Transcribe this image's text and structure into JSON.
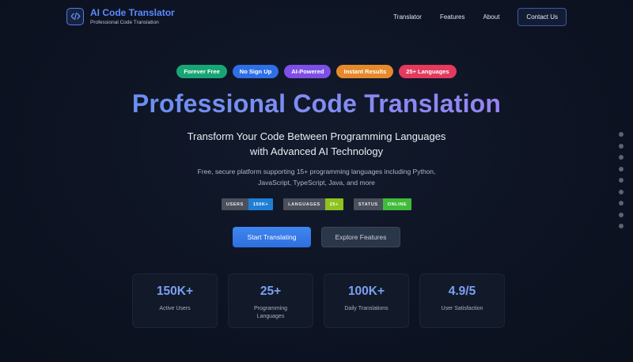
{
  "brand": {
    "title": "AI Code Translator",
    "subtitle": "Professional Code Translation",
    "logo_icon": "code-brackets-icon",
    "accent": "#5b8bff"
  },
  "nav": {
    "links": [
      "Translator",
      "Features",
      "About"
    ],
    "contact_label": "Contact Us"
  },
  "badges": [
    {
      "label": "Forever Free",
      "color": "#17a673"
    },
    {
      "label": "No Sign Up",
      "color": "#2f6fe6"
    },
    {
      "label": "AI-Powered",
      "color": "#7e4fe6"
    },
    {
      "label": "Instant Results",
      "color": "#e58a2b"
    },
    {
      "label": "25+ Languages",
      "color": "#e33a5d"
    }
  ],
  "hero": {
    "title": "Professional Code Translation",
    "subtitle_line1": "Transform Your Code Between Programming Languages",
    "subtitle_line2": "with Advanced AI Technology",
    "desc_line1": "Free, secure platform supporting 15+ programming languages including Python,",
    "desc_line2": "JavaScript, TypeScript, Java, and more"
  },
  "status_pills": [
    {
      "key": "USERS",
      "value": "150K+",
      "color": "#1f7fd6"
    },
    {
      "key": "LANGUAGES",
      "value": "25+",
      "color": "#8fc21f"
    },
    {
      "key": "STATUS",
      "value": "ONLINE",
      "color": "#3fbd3a"
    }
  ],
  "cta": {
    "primary": "Start Translating",
    "secondary": "Explore Features"
  },
  "stats": [
    {
      "number": "150K+",
      "label": "Active Users"
    },
    {
      "number": "25+",
      "label": "Programming Languages"
    },
    {
      "number": "100K+",
      "label": "Daily Translations"
    },
    {
      "number": "4.9/5",
      "label": "User Satisfaction"
    }
  ],
  "section_dots_count": 9
}
